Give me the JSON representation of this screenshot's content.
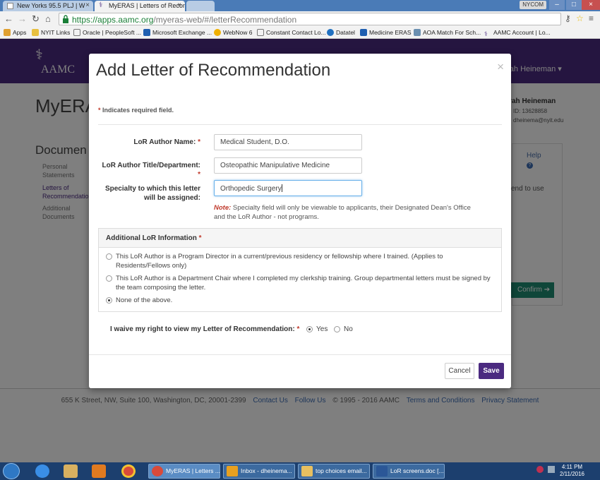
{
  "browser": {
    "tabs": [
      {
        "label": "New Yorks 95.5 PLJ | W",
        "active": false
      },
      {
        "label": "MyERAS | Letters of Recom",
        "active": true
      },
      {
        "label": "",
        "active": false
      }
    ],
    "window_label": "NYCOM",
    "url_host": "https://apps.aamc.org",
    "url_path": "/myeras-web/#/letterRecommendation",
    "bookmarks": [
      "Apps",
      "NYIT Links",
      "Oracle | PeopleSoft ...",
      "Microsoft Exchange ...",
      "WebNow 6",
      "Constant Contact Lo...",
      "Datatel",
      "Medicine ERAS",
      "AOA Match For Sch...",
      "AAMC Account | Lo..."
    ]
  },
  "page": {
    "logo_text": "AAMC",
    "user_menu": "orah Heineman",
    "title": "MyERA",
    "user_name": "orah Heineman",
    "user_id": "ID: 13628858",
    "user_email": "dheinema@nyit.edu",
    "sidebar_title": "Documen",
    "sidebar_links": [
      "Personal Statements",
      "Letters of Recommendation",
      "Additional Documents"
    ],
    "help": "Help",
    "send_text": "end to use",
    "confirm": "Confirm",
    "footer_address": "655 K Street, NW, Suite 100, Washington, DC, 20001-2399",
    "footer_links": [
      "Contact Us",
      "Follow Us"
    ],
    "footer_copyright": "© 1995 - 2016 AAMC",
    "footer_links2": [
      "Terms and Conditions",
      "Privacy Statement"
    ]
  },
  "modal": {
    "title": "Add Letter of Recommendation",
    "close": "×",
    "required_note": "Indicates required field.",
    "fields": {
      "author_name_label": "LoR Author Name:",
      "author_name_value": "Medical Student, D.O.",
      "author_title_label": "LoR Author Title/Department:",
      "author_title_value": "Osteopathic Manipulative Medicine",
      "specialty_label_1": "Specialty to which this letter",
      "specialty_label_2": "will be assigned:",
      "specialty_value": "Orthopedic Surgery"
    },
    "note_prefix": "Note:",
    "note_text": "Specialty field will only be viewable to applicants, their Designated Dean's Office and the LoR Author - not programs.",
    "additional_info_heading": "Additional LoR Information",
    "radio_options": [
      {
        "label": "This LoR Author is a Program Director in a current/previous residency or fellowship where I trained. (Applies to Residents/Fellows only)",
        "selected": false
      },
      {
        "label": "This LoR Author is a Department Chair where I completed my clerkship training. Group departmental letters must be signed by the team composing the letter.",
        "selected": false
      },
      {
        "label": "None of the above.",
        "selected": true
      }
    ],
    "waive_label": "I waive my right to view my Letter of Recommendation:",
    "waive_yes": "Yes",
    "waive_no": "No",
    "waive_selected": "Yes",
    "cancel": "Cancel",
    "save": "Save"
  },
  "taskbar": {
    "items": [
      "MyERAS | Letters ...",
      "Inbox - dheinema...",
      "top choices email...",
      "LoR screens.doc [..."
    ],
    "time": "4:11 PM",
    "date": "2/11/2016"
  },
  "colors": {
    "brand_purple": "#4b2a80",
    "confirm_green": "#1e8c72",
    "required_red": "#c0392b",
    "link_blue": "#3d6db4"
  }
}
